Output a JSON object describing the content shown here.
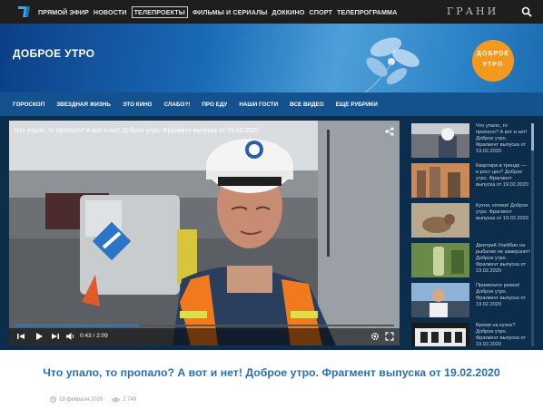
{
  "topbar": {
    "nav": [
      "Прямой эфир",
      "Новости",
      "Телепроекты",
      "Фильмы и сериалы",
      "Доккино",
      "Спорт",
      "Телепрограмма"
    ],
    "active_index": 2,
    "brand_right": "ГРАНИ"
  },
  "banner": {
    "title": "ДОБРОЕ УТРО",
    "logo_lines": [
      "ДОБРОЕ",
      "УТРО"
    ]
  },
  "subnav": [
    "Гороскоп",
    "Звездная жизнь",
    "Это кино",
    "Слабо?!",
    "Про еду",
    "Наши гости",
    "Все видео",
    "Еще рубрики"
  ],
  "player": {
    "title": "Что упало, то пропало? А вот и нет! Доброе утро. Фрагмент выпуска от 19.02.2020",
    "time": "0:43 / 2:09",
    "progress": 0.33
  },
  "related": [
    {
      "title": "Что упало, то пропало? А вот и нет! Доброе утро. Фрагмент выпуска от 19.02.2020",
      "thumb": "highway"
    },
    {
      "title": "Квартира в тренде — и рост цен? Доброе утро. Фрагмент выпуска от 19.02.2020",
      "thumb": "city"
    },
    {
      "title": "Кухня, котики! Доброе утро. Фрагмент выпуска от 19.02.2020",
      "thumb": "cat"
    },
    {
      "title": "Дмитрий Улейбин на рыбалке не замерзнет! Доброе утро. Фрагмент выпуска от 19.02.2020",
      "thumb": "bottle"
    },
    {
      "title": "Примените ремни! Доброе утро. Фрагмент выпуска от 19.02.2020",
      "thumb": "car"
    },
    {
      "title": "Время на кухне? Доброе утро. Фрагмент выпуска от 19.02.2020",
      "thumb": "clock"
    }
  ],
  "main": {
    "title": "Что упало, то пропало? А вот и нет! Доброе утро. Фрагмент выпуска от 19.02.2020",
    "date": "19 февраля 2020",
    "views": "2 749"
  },
  "colors": {
    "topbar": "#1e1e1e",
    "subnav": "#14518f",
    "accent": "#2b6fb4",
    "logo": "#f39a1e"
  }
}
